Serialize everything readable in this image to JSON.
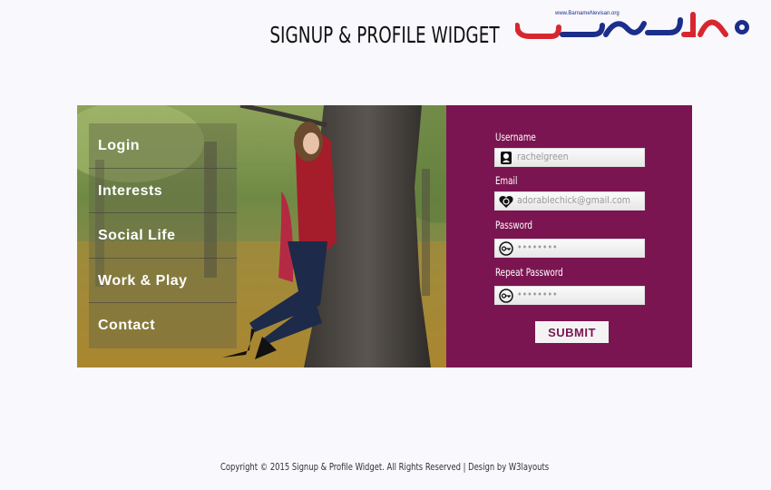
{
  "header": {
    "title": "SIGNUP & PROFILE WIDGET",
    "logo_url": "www.BarnameNevisan.org",
    "logo_text": "برنامه نویسان"
  },
  "menu": {
    "items": [
      {
        "label": "Login"
      },
      {
        "label": "Interests"
      },
      {
        "label": "Social Life"
      },
      {
        "label": "Work & Play"
      },
      {
        "label": "Contact"
      }
    ]
  },
  "form": {
    "username_label": "Username",
    "username_value": "rachelgreen",
    "email_label": "Email",
    "email_value": "adorablechick@gmail.com",
    "password_label": "Password",
    "password_value": "••••••••",
    "repeat_password_label": "Repeat Password",
    "repeat_password_value": "••••••••",
    "submit_label": "SUBMIT"
  },
  "footer": {
    "text": "Copyright © 2015 Signup & Profile Widget. All Rights Reserved | Design by W3layouts"
  },
  "colors": {
    "panel": "#7b1551",
    "background": "#f8f8fd",
    "logo_red": "#d8262f",
    "logo_blue": "#1b2e8a"
  },
  "icons": [
    "user-icon",
    "email-icon",
    "key-icon",
    "key-icon"
  ]
}
